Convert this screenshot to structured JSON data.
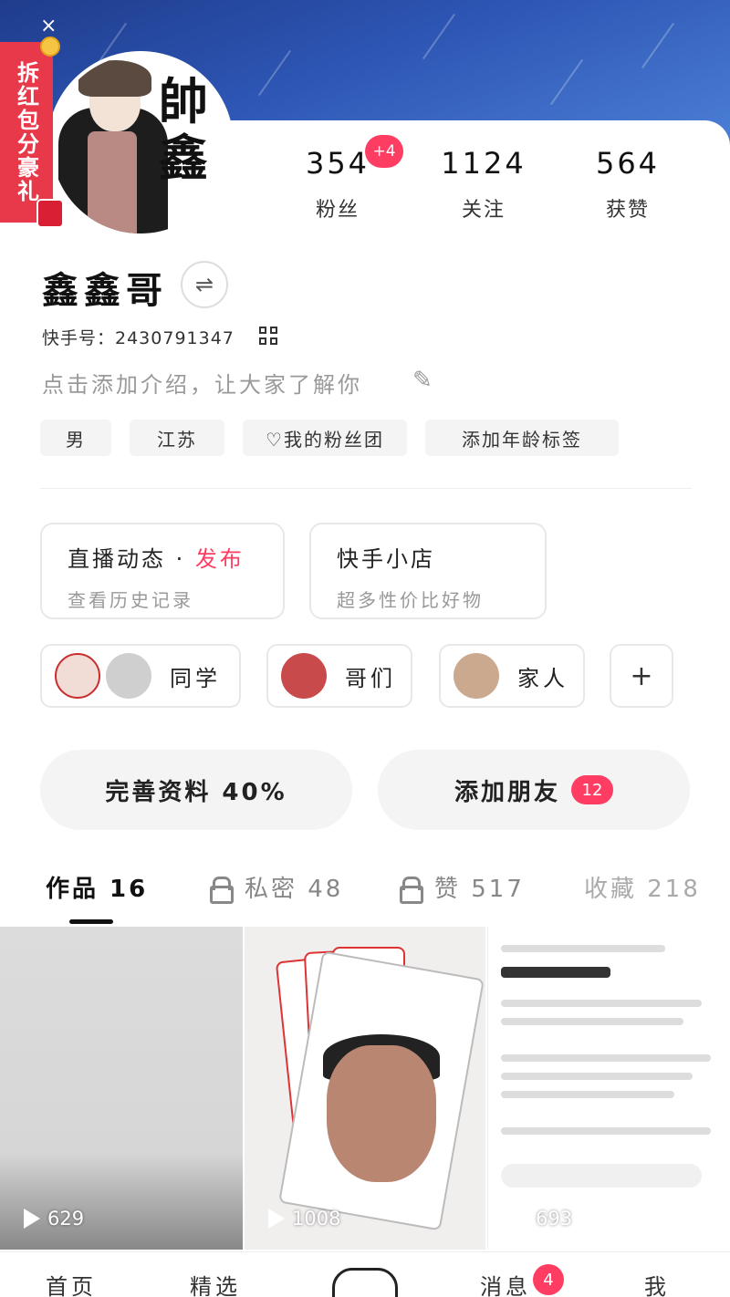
{
  "redpack": {
    "label": "拆红包分豪礼",
    "close": "×"
  },
  "stats": {
    "fans": {
      "count": "354",
      "label": "粉丝",
      "new_badge": "+4"
    },
    "following": {
      "count": "1124",
      "label": "关注"
    },
    "likes": {
      "count": "564",
      "label": "获赞"
    }
  },
  "profile": {
    "name": "鑫鑫哥",
    "switch_icon": "⇌",
    "kuaishou_id": "快手号：2430791347",
    "intro_placeholder": "点击添加介绍，让大家了解你",
    "avatar_text": "帥鑫"
  },
  "tags": [
    {
      "label": "男"
    },
    {
      "label": "江苏"
    },
    {
      "label": "♡我的粉丝团"
    },
    {
      "label": "添加年龄标签"
    }
  ],
  "cards": {
    "live": {
      "title": "直播动态 · ",
      "title_action": "发布",
      "subtitle": "查看历史记录"
    },
    "shop": {
      "title": "快手小店",
      "subtitle": "超多性价比好物"
    }
  },
  "groups": [
    {
      "label": "同学"
    },
    {
      "label": "哥们"
    },
    {
      "label": "家人"
    }
  ],
  "actions": {
    "complete_profile": "完善资料 40%",
    "add_friends": "添加朋友",
    "add_friends_badge": "12"
  },
  "content_tabs": [
    {
      "label": "作品 16"
    },
    {
      "label": "私密 48"
    },
    {
      "label": "赞 517"
    },
    {
      "label": "收藏 218"
    }
  ],
  "videos": [
    {
      "views": "629"
    },
    {
      "views": "1008"
    },
    {
      "views": "693"
    }
  ],
  "bottom_nav": {
    "home": "首页",
    "featured": "精选",
    "messages": "消息",
    "messages_badge": "4",
    "me": "我"
  },
  "colors": {
    "accent": "#ff3d63",
    "hero": "#2d55b3",
    "redpack": "#e8394a"
  }
}
